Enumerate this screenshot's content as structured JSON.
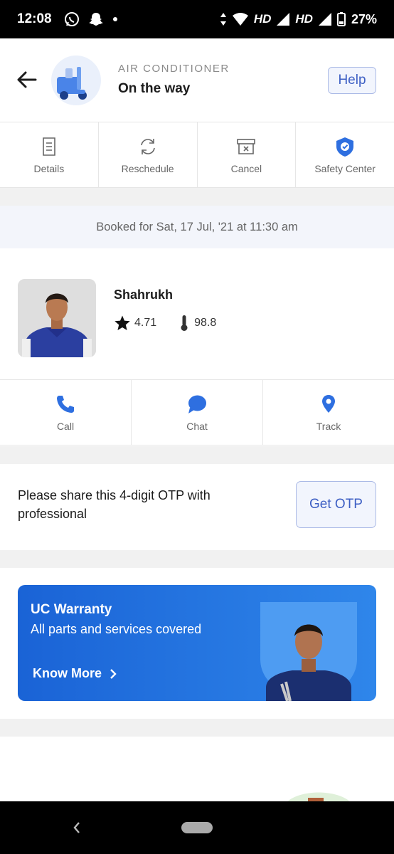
{
  "status_bar": {
    "time": "12:08",
    "network_1": "HD",
    "network_2": "HD",
    "battery": "27%"
  },
  "header": {
    "category": "AIR CONDITIONER",
    "status": "On the way",
    "help_label": "Help",
    "back_icon": "arrow-left-icon",
    "avatar_icon": "scooter-icon"
  },
  "actions": [
    {
      "label": "Details",
      "icon": "document-icon"
    },
    {
      "label": "Reschedule",
      "icon": "refresh-icon"
    },
    {
      "label": "Cancel",
      "icon": "cancel-box-icon"
    },
    {
      "label": "Safety Center",
      "icon": "shield-check-icon"
    }
  ],
  "booking": {
    "text": "Booked for Sat, 17 Jul, '21 at 11:30 am"
  },
  "professional": {
    "name": "Shahrukh",
    "rating": "4.71",
    "temperature": "98.8"
  },
  "contact": [
    {
      "label": "Call",
      "icon": "phone-icon"
    },
    {
      "label": "Chat",
      "icon": "chat-icon"
    },
    {
      "label": "Track",
      "icon": "location-pin-icon"
    }
  ],
  "otp": {
    "text": "Please share this 4-digit OTP with professional",
    "button": "Get OTP"
  },
  "warranty": {
    "title": "UC Warranty",
    "subtitle": "All parts and services covered",
    "link": "Know More"
  },
  "colors": {
    "accent": "#3d5fc4",
    "icon_blue": "#2e6fe0",
    "banner_blue": "#1a63d6"
  }
}
